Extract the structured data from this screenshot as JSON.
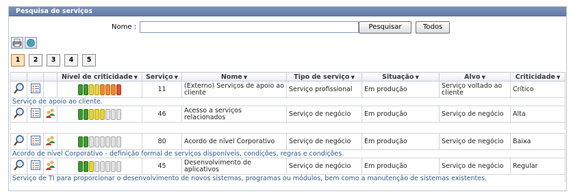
{
  "panel": {
    "title": "Pesquisa de serviços"
  },
  "search": {
    "label": "Nome :",
    "value": "",
    "placeholder": "",
    "search_button": "Pesquisar",
    "all_button": "Todos"
  },
  "toolbar": {
    "icons": [
      "printer-icon",
      "globe-icon"
    ]
  },
  "pagination": {
    "pages": [
      "1",
      "2",
      "3",
      "4",
      "5"
    ],
    "active": "1"
  },
  "table": {
    "headers": {
      "criticidade_nivel": "Nível de criticidade",
      "servico": "Serviço",
      "nome": "Nome",
      "tipo": "Tipo de serviço",
      "situacao": "Situação",
      "alvo": "Alvo",
      "criticidade": "Criticidade"
    },
    "rows": [
      {
        "bars": [
          "green",
          "green",
          "yellow",
          "yellow",
          "orange",
          "orange",
          "orange",
          "red"
        ],
        "servico": "11",
        "nome": "(Externo) Serviços de apoio ao cliente",
        "tipo": "Serviço profissional",
        "situacao": "Em produção",
        "alvo": "Serviço voltado ao cliente",
        "criticidade": "Crítico",
        "has_people_icon": false,
        "descricao": "Serviço de apoio ao cliente."
      },
      {
        "bars": [
          "green",
          "green",
          "yellow",
          "yellow",
          "yellow",
          "gray",
          "gray",
          "gray"
        ],
        "servico": "46",
        "nome": "Acesso a serviços relacionados",
        "tipo": "Serviço de negócio",
        "situacao": "Em produção",
        "alvo": "Serviço de negócio",
        "criticidade": "Alta",
        "has_people_icon": true,
        "descricao": ""
      },
      {
        "bars": [
          "green",
          "green",
          "gray",
          "gray",
          "gray",
          "gray",
          "gray",
          "gray"
        ],
        "servico": "80",
        "nome": "Acordo de nível Corporativo",
        "tipo": "Serviço de negócio",
        "situacao": "Em produção",
        "alvo": "Serviço de negócio",
        "criticidade": "Baixa",
        "has_people_icon": true,
        "descricao": "Acordo de nível Corporativo - definição formal de serviços disponíveis, condições, regras e condições."
      },
      {
        "bars": [
          "green",
          "green",
          "yellow",
          "gray",
          "gray",
          "gray",
          "gray",
          "gray"
        ],
        "servico": "45",
        "nome": "Desenvolvimento de aplicativos",
        "tipo": "Serviço de negócio",
        "situacao": "Em produção",
        "alvo": "Serviço de negócio",
        "criticidade": "Regular",
        "has_people_icon": true,
        "descricao": "Serviço de TI para proporcionar o desenvolvimento de novos sistemas, programas ou módulos, bem como a manutenção de sistemas existentes."
      }
    ]
  },
  "colors": {
    "green": "#3c9a2e",
    "yellow": "#e8d432",
    "orange": "#f08a2a",
    "red": "#e0522c",
    "gray": "#e2e2e2",
    "header_bar": "#6a83ad"
  }
}
